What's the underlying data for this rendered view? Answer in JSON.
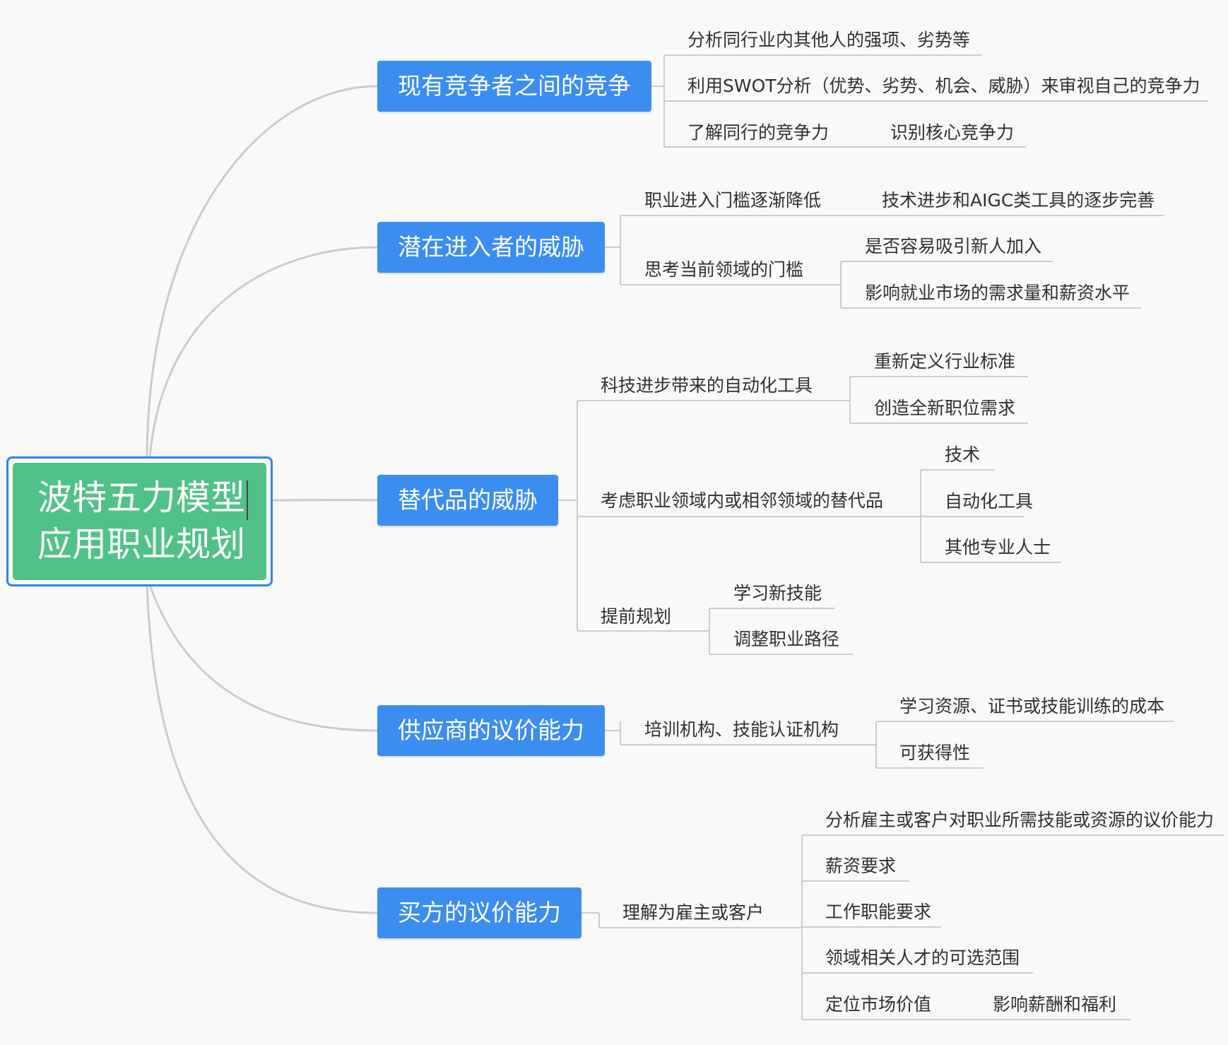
{
  "colors": {
    "background": "#f9f9f9",
    "root_fill": "#50c288",
    "root_border": "#2f86ea",
    "topic_fill": "#3b8df0",
    "connector": "#cccccc"
  },
  "root": {
    "line1": "波特五力模型",
    "line2": "应用职业规划"
  },
  "forces": [
    {
      "label": "现有竞争者之间的竞争",
      "items": [
        "分析同行业内其他人的强项、劣势等",
        "利用SWOT分析（优势、劣势、机会、威胁）来审视自己的竞争力",
        {
          "label": "了解同行的竞争力",
          "child": "识别核心竞争力"
        }
      ]
    },
    {
      "label": "潜在进入者的威胁",
      "items": [
        {
          "label": "职业进入门槛逐渐降低",
          "child": "技术进步和AIGC类工具的逐步完善"
        },
        {
          "label": "思考当前领域的门槛",
          "children": [
            "是否容易吸引新人加入",
            "影响就业市场的需求量和薪资水平"
          ]
        }
      ]
    },
    {
      "label": "替代品的威胁",
      "items": [
        {
          "label": "科技进步带来的自动化工具",
          "children": [
            "重新定义行业标准",
            "创造全新职位需求"
          ]
        },
        {
          "label": "考虑职业领域内或相邻领域的替代品",
          "children": [
            "技术",
            "自动化工具",
            "其他专业人士"
          ]
        },
        {
          "label": "提前规划",
          "children": [
            "学习新技能",
            "调整职业路径"
          ]
        }
      ]
    },
    {
      "label": "供应商的议价能力",
      "items": [
        {
          "label": "培训机构、技能认证机构",
          "children": [
            "学习资源、证书或技能训练的成本",
            "可获得性"
          ]
        }
      ]
    },
    {
      "label": "买方的议价能力",
      "items": [
        {
          "label": "理解为雇主或客户",
          "children": [
            "分析雇主或客户对职业所需技能或资源的议价能力",
            "薪资要求",
            "工作职能要求",
            "领域相关人才的可选范围",
            {
              "label": "定位市场价值",
              "child": "影响薪酬和福利"
            }
          ]
        }
      ]
    }
  ]
}
